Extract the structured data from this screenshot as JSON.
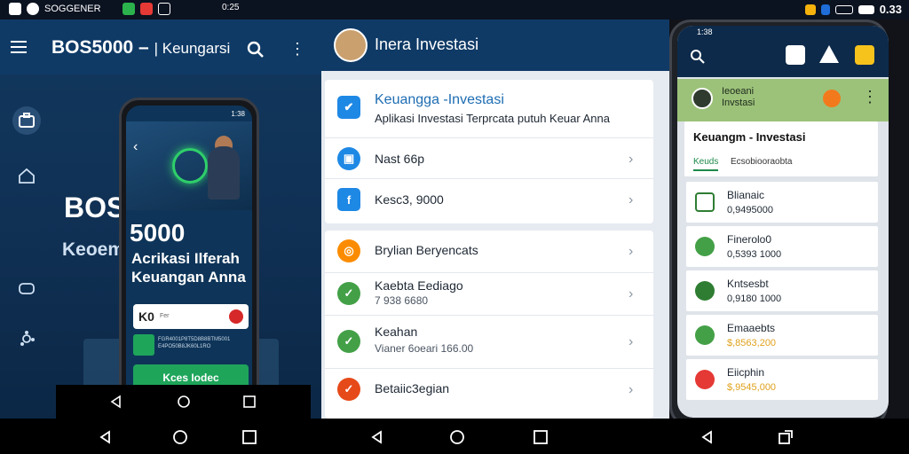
{
  "status_bar": {
    "time": "0.33",
    "left_text": "SOGGENER",
    "mid_time": "0:25"
  },
  "left_panel": {
    "title": "BOS5000 –",
    "title_sub": "| Keungarsi",
    "big_text": "BOS",
    "big_text2": "Keoem",
    "phone": {
      "status": "1:38",
      "headline": "5000",
      "sub_headline": "Acrikasi Ilferah Keuangan Anna",
      "card_label": "K0",
      "card_small": "Fer",
      "row_text": "FGR4001P8T5D8B8BTM5001 E4PO50B8JK60L1RO",
      "button_label": "Kces Iodec"
    }
  },
  "middle_panel": {
    "header_title": "Inera Investasi",
    "card1": {
      "heading": "Keuangga -Investasi",
      "subheading": "Aplikasi Investasi Terprcata putuh Keuar Anna"
    },
    "card2_rows": [
      {
        "label": "Nast 66p"
      },
      {
        "label": "Kesc3, 9000"
      }
    ],
    "card3_rows": [
      {
        "label": "Brylian Beryencats",
        "value": ""
      },
      {
        "label": "Kaebta Eediago",
        "value": "7 938 6680"
      },
      {
        "label": "Keahan",
        "value": "Vianer  6oeari 166.00"
      },
      {
        "label": "Betaiic3egian",
        "value": ""
      }
    ],
    "colors": {
      "blue": "#1e88e5",
      "green": "#43a047",
      "orange": "#fb8c00",
      "red": "#e53935"
    }
  },
  "right_panel": {
    "status": "1:38",
    "status_right": "0.33",
    "green_bar_line1": "Ieoeani",
    "green_bar_line2": "Invstasi",
    "card_title": "Keuangm - Investasi",
    "tab_active": "Keuds",
    "tab_inactive": "Ecsobiooraobta",
    "items": [
      {
        "name": "Blianaic",
        "value": "0,9495000",
        "color": "#2e7d32",
        "highlight": false
      },
      {
        "name": "Finerolo0",
        "value": "0,5393 1000",
        "color": "#43a047",
        "highlight": false
      },
      {
        "name": "Kntsesbt",
        "value": "0,9180 1000",
        "color": "#2e7d32",
        "highlight": false
      },
      {
        "name": "Emaaebts",
        "value": "$,8563,200",
        "color": "#43a047",
        "highlight": true
      },
      {
        "name": "Eiicphin",
        "value": "$,9545,000",
        "color": "#e53935",
        "highlight": true
      }
    ]
  }
}
